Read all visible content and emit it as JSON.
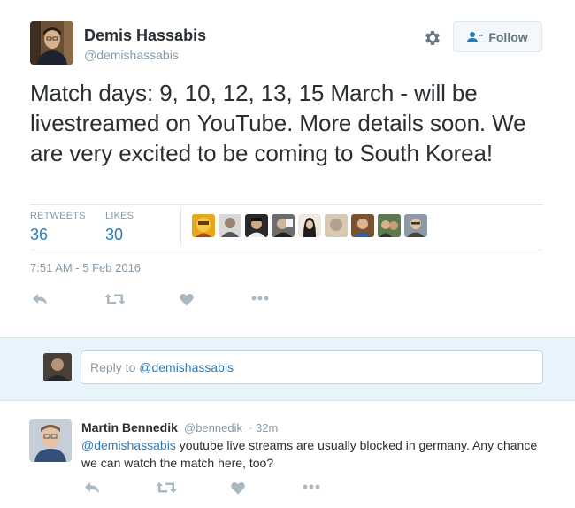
{
  "tweet": {
    "author": {
      "name": "Demis Hassabis",
      "handle": "@demishassabis"
    },
    "follow_label": "Follow",
    "text": "Match days: 9, 10, 12, 13, 15 March - will be livestreamed on YouTube. More details soon. We are very excited to be coming to South Korea!",
    "stats": {
      "retweets_label": "RETWEETS",
      "retweets": "36",
      "likes_label": "LIKES",
      "likes": "30"
    },
    "liker_avatars": [
      "avatar-1",
      "avatar-2",
      "avatar-3",
      "avatar-4",
      "avatar-5",
      "avatar-6",
      "avatar-7",
      "avatar-8",
      "avatar-9"
    ],
    "timestamp": "7:51 AM - 5 Feb 2016",
    "actions": [
      "reply-icon",
      "retweet-icon",
      "heart-icon",
      "more-icon"
    ]
  },
  "reply_box": {
    "prefix": "Reply to ",
    "mention": "@demishassabis"
  },
  "reply": {
    "name": "Martin Bennedik",
    "handle": "@bennedik",
    "separator": "·",
    "time": "32m",
    "mention": "@demishassabis",
    "text": " youtube live streams are usually blocked in germany. Any chance we can watch the match here, too?"
  },
  "colors": {
    "link_blue": "#2b7bb9",
    "muted_gray": "#8899a6",
    "reply_bg": "#e8f4fb"
  }
}
